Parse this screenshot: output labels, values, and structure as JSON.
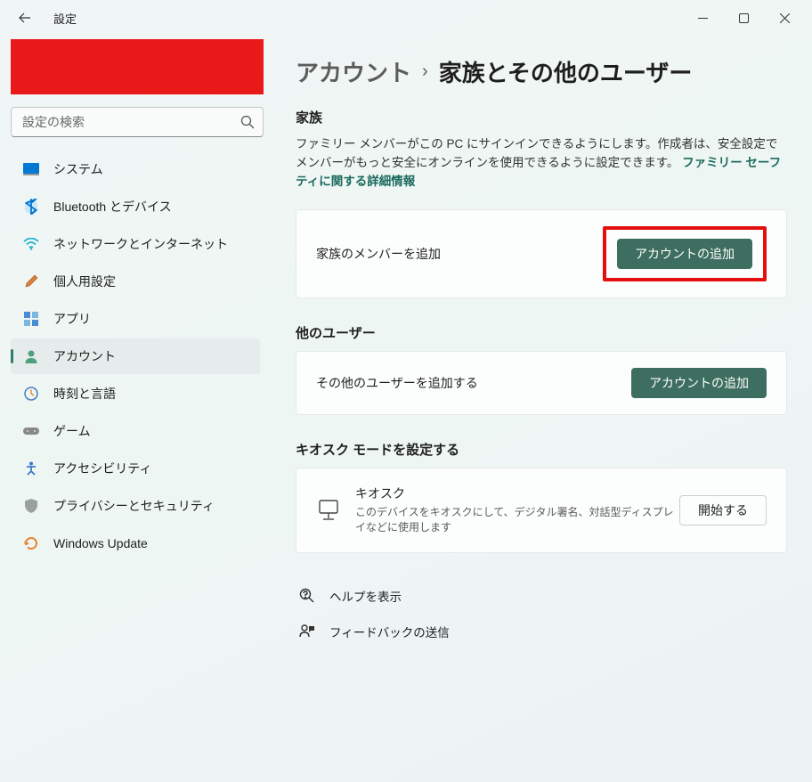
{
  "app_title": "設定",
  "search": {
    "placeholder": "設定の検索"
  },
  "nav": {
    "system": "システム",
    "bluetooth": "Bluetooth とデバイス",
    "network": "ネットワークとインターネット",
    "personalization": "個人用設定",
    "apps": "アプリ",
    "accounts": "アカウント",
    "time": "時刻と言語",
    "gaming": "ゲーム",
    "accessibility": "アクセシビリティ",
    "privacy": "プライバシーとセキュリティ",
    "update": "Windows Update"
  },
  "breadcrumb": {
    "parent": "アカウント",
    "current": "家族とその他のユーザー"
  },
  "family": {
    "heading": "家族",
    "desc_text": "ファミリー メンバーがこの PC にサインインできるようにします。作成者は、安全設定でメンバーがもっと安全にオンラインを使用できるように設定できます。 ",
    "link_text": "ファミリー セーフティに関する詳細情報",
    "card_label": "家族のメンバーを追加",
    "button": "アカウントの追加"
  },
  "other": {
    "heading": "他のユーザー",
    "card_label": "その他のユーザーを追加する",
    "button": "アカウントの追加"
  },
  "kiosk": {
    "heading": "キオスク モードを設定する",
    "title": "キオスク",
    "desc": "このデバイスをキオスクにして、デジタル署名、対話型ディスプレイなどに使用します",
    "button": "開始する"
  },
  "footer": {
    "help": "ヘルプを表示",
    "feedback": "フィードバックの送信"
  }
}
